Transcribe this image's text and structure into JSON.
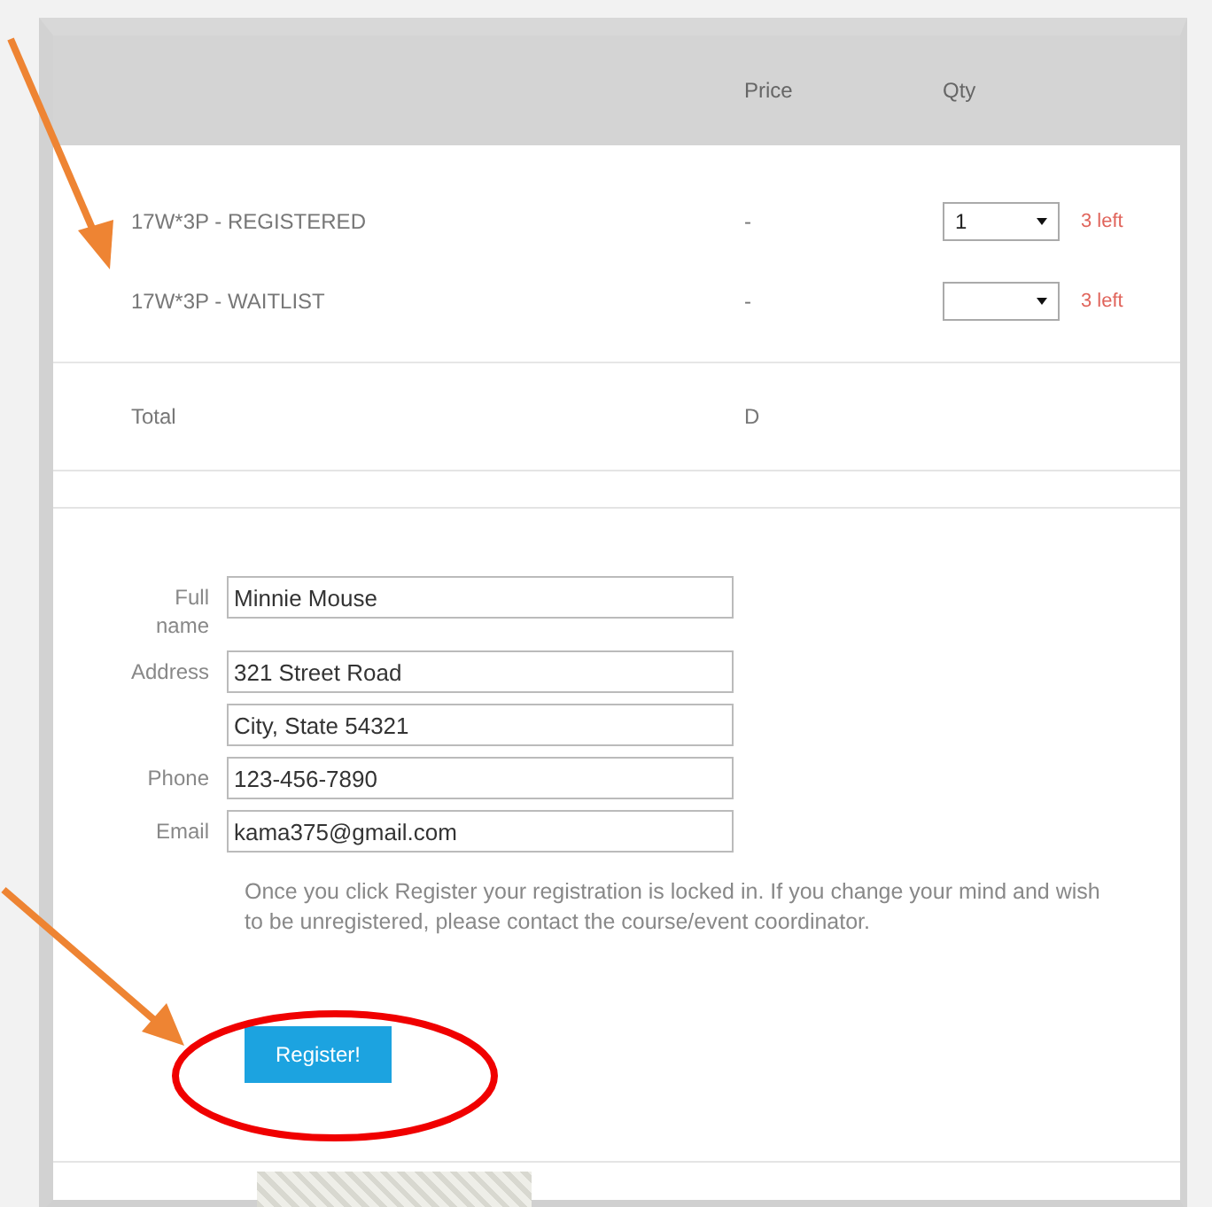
{
  "table": {
    "columns": [
      "Price",
      "Qty"
    ],
    "rows": [
      {
        "name": "17W*3P - REGISTERED",
        "price": "-",
        "qty": "1",
        "remaining": "3 left"
      },
      {
        "name": "17W*3P - WAITLIST",
        "price": "-",
        "remaining": "3 left"
      }
    ],
    "total": {
      "label": "Total",
      "value": "D"
    }
  },
  "form": {
    "fields": [
      {
        "label": "Full name",
        "value": "Minnie Mouse"
      },
      {
        "label": "Address",
        "value": "321 Street Road"
      },
      {
        "value": "City, State 54321"
      },
      {
        "label": "Phone",
        "value": "123-456-7890"
      },
      {
        "label": "Email",
        "value": "kama375@gmail.com"
      }
    ],
    "note": "Once you click Register your registration is locked in. If you change your mind and wish to be unregistered, please contact the course/event coordinator.",
    "submit": "Register!"
  }
}
